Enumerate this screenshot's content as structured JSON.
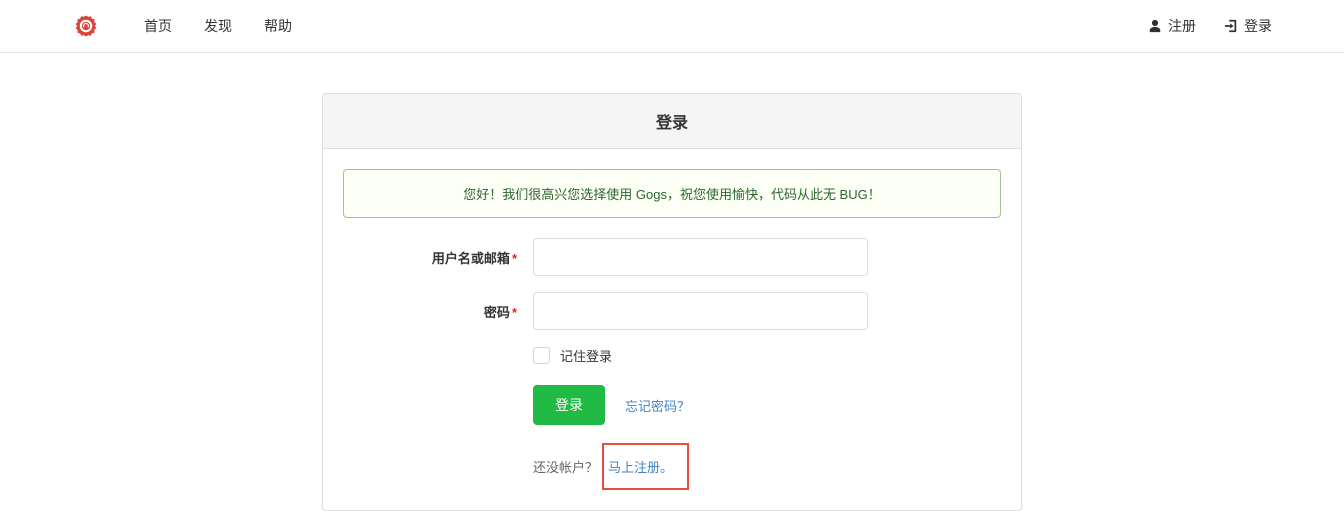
{
  "nav": {
    "home": "首页",
    "explore": "发现",
    "help": "帮助",
    "register": "注册",
    "login": "登录"
  },
  "panel": {
    "title": "登录",
    "message": "您好！我们很高兴您选择使用 Gogs，祝您使用愉快，代码从此无 BUG！",
    "username_label": "用户名或邮箱",
    "password_label": "密码",
    "remember_label": "记住登录",
    "login_button": "登录",
    "forgot_link": "忘记密码？",
    "no_account_text": "还没帐户？",
    "signup_link": "马上注册。"
  }
}
